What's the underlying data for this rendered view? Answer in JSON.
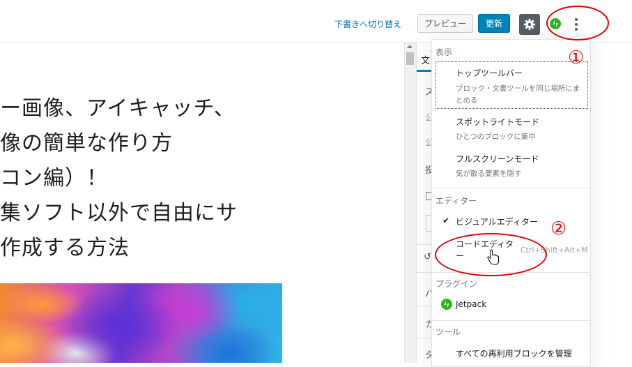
{
  "topbar": {
    "switch_to_draft": "下書きへ切り替え",
    "preview": "プレビュー",
    "update": "更新"
  },
  "icons": {
    "settings": "gear-icon",
    "jetpack": "jetpack-icon",
    "more": "vertical-ellipsis-icon",
    "checkmark": "check-icon",
    "cursor": "hand-pointer-icon"
  },
  "colors": {
    "accent_blue": "#0085ba",
    "annotation_red": "#e00000",
    "jetpack_green": "#2fb41f"
  },
  "annotations": {
    "one": "①",
    "two": "②"
  },
  "post_title_lines": [
    "ー画像、アイキャッチ、",
    "像の簡単な作り方",
    "コン編）！",
    "集ソフト以外で自由にサ",
    "作成する方法"
  ],
  "sidebar_partial": {
    "tab": "文",
    "glyphs": [
      "ス",
      "公",
      "公",
      "投",
      "パ",
      "カ",
      "タ"
    ]
  },
  "menu": {
    "view_label": "表示",
    "top_toolbar": "トップツールバー",
    "top_toolbar_desc_1": "ブロック・文書ツールを同じ場所にま",
    "top_toolbar_desc_2": "とめる",
    "spotlight": "スポットライトモード",
    "spotlight_desc": "ひとつのブロックに集中",
    "fullscreen": "フルスクリーンモード",
    "fullscreen_desc": "気が散る要素を隠す",
    "editor_label": "エディター",
    "visual_editor": "ビジュアルエディター",
    "code_editor_1": "コードエディタ",
    "code_editor_2": "ー",
    "code_editor_shortcut": "Ctrl+Shift+Alt+M",
    "plugins_label": "プラグイン",
    "jetpack": "Jetpack",
    "tools_label": "ツール",
    "manage_reusable": "すべての再利用ブロックを管理"
  }
}
